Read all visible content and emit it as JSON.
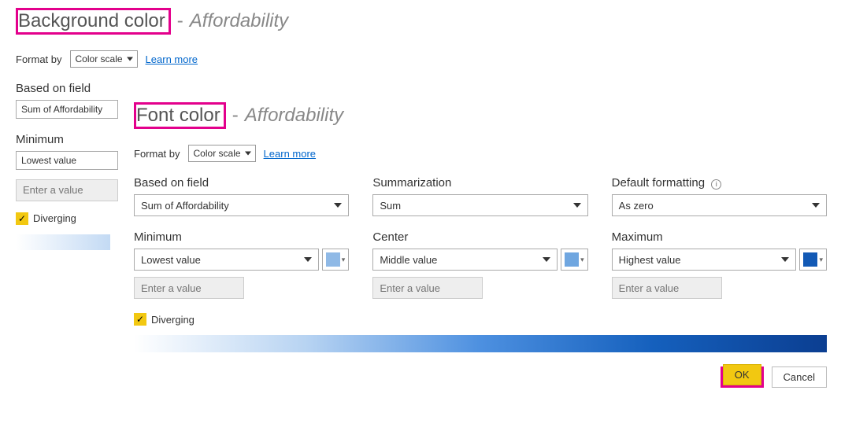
{
  "backDialog": {
    "title": "Background color",
    "subject": "Affordability",
    "separator": "-",
    "formatByLabel": "Format by",
    "formatByValue": "Color scale",
    "learnMore": "Learn more",
    "basedOnFieldLabel": "Based on field",
    "basedOnFieldValue": "Sum of Affordability",
    "minimumLabel": "Minimum",
    "minimumValue": "Lowest value",
    "minimumPlaceholder": "Enter a value",
    "divergingLabel": "Diverging"
  },
  "frontDialog": {
    "title": "Font color",
    "subject": "Affordability",
    "separator": "-",
    "formatByLabel": "Format by",
    "formatByValue": "Color scale",
    "learnMore": "Learn more",
    "basedOnFieldLabel": "Based on field",
    "basedOnFieldValue": "Sum of Affordability",
    "summarizationLabel": "Summarization",
    "summarizationValue": "Sum",
    "defaultFormattingLabel": "Default formatting",
    "defaultFormattingValue": "As zero",
    "infoGlyph": "i",
    "minimum": {
      "label": "Minimum",
      "value": "Lowest value",
      "placeholder": "Enter a value",
      "color": "#8fb9e6"
    },
    "center": {
      "label": "Center",
      "value": "Middle value",
      "placeholder": "Enter a value",
      "color": "#6fa6e0"
    },
    "maximum": {
      "label": "Maximum",
      "value": "Highest value",
      "placeholder": "Enter a value",
      "color": "#1259b5"
    },
    "divergingLabel": "Diverging",
    "okLabel": "OK",
    "cancelLabel": "Cancel"
  },
  "icons": {
    "check": "✓"
  }
}
